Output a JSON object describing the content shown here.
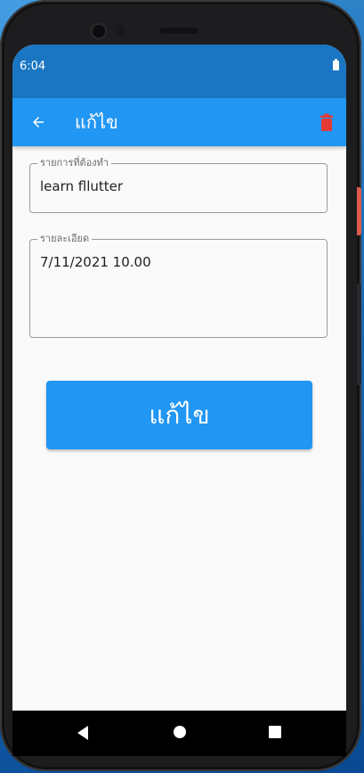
{
  "status_bar": {
    "time": "6:04"
  },
  "app_bar": {
    "title": "แก้ไข",
    "back_icon": "arrow-back-icon",
    "delete_icon": "trash-icon",
    "delete_color": "#e53935"
  },
  "form": {
    "todo": {
      "label": "รายการที่ต้องทำ",
      "value": "learn fllutter"
    },
    "detail": {
      "label": "รายละเอียด",
      "value": "7/11/2021 10.00"
    },
    "submit_label": "แก้ไข"
  },
  "colors": {
    "primary": "#2196f3",
    "status_bar": "#1a76c2"
  },
  "nav_bar": {
    "back_icon": "nav-back-icon",
    "home_icon": "nav-home-icon",
    "recents_icon": "nav-recents-icon"
  }
}
